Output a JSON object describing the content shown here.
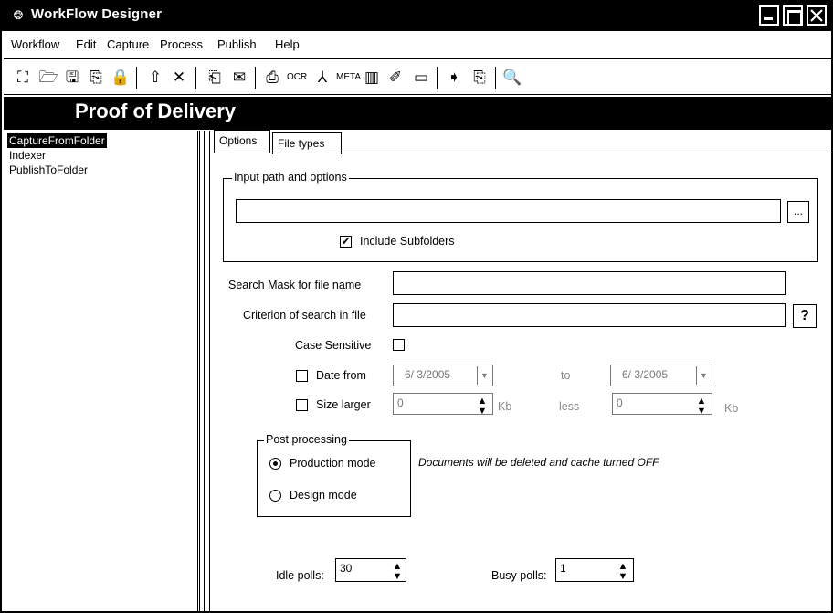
{
  "window": {
    "title": "WorkFlow Designer"
  },
  "menu": [
    "Workflow",
    "Edit",
    "Capture",
    "Process",
    "Publish",
    "Help"
  ],
  "toolbar": {
    "icons": [
      "new-icon",
      "open-icon",
      "save-icon",
      "save-as-icon",
      "lock-icon",
      "up-arrow-icon",
      "delete-icon",
      "capture-icon",
      "mail-icon",
      "scan-icon",
      "ocr-icon",
      "signature-icon",
      "meta-icon",
      "barcode-icon",
      "check-icon",
      "image-icon",
      "export-icon",
      "publish-icon",
      "preview-icon"
    ]
  },
  "banner": {
    "title": "Proof of Delivery"
  },
  "tree": {
    "items": [
      "CaptureFromFolder",
      "Indexer",
      "PublishToFolder"
    ],
    "selected_index": 0
  },
  "tabs": [
    "Options",
    "File types"
  ],
  "input_group": {
    "label": "Input path and options",
    "path_value": "",
    "browse_label": "...",
    "include_subfolders_label": "Include Subfolders",
    "include_subfolders_checked": true
  },
  "search_mask": {
    "label": "Search Mask for file name",
    "value": ""
  },
  "criterion": {
    "label": "Criterion of search in file",
    "value": "",
    "help_label": "?"
  },
  "case_sensitive": {
    "label": "Case Sensitive",
    "checked": false
  },
  "date_from": {
    "label": "Date from",
    "checked": false,
    "from_value": "6/ 3/2005",
    "to_label": "to",
    "to_value": "6/ 3/2005"
  },
  "size_larger": {
    "label": "Size larger",
    "checked": false,
    "larger_value": "0",
    "unit1": "Kb",
    "less_label": "less",
    "less_value": "0",
    "unit2": "Kb"
  },
  "post_processing": {
    "label": "Post processing",
    "production_label": "Production mode",
    "design_label": "Design mode",
    "selected": "production",
    "note": "Documents will be deleted and cache turned OFF"
  },
  "polls": {
    "idle_label": "Idle polls:",
    "idle_value": "30",
    "busy_label": "Busy polls:",
    "busy_value": "1"
  }
}
